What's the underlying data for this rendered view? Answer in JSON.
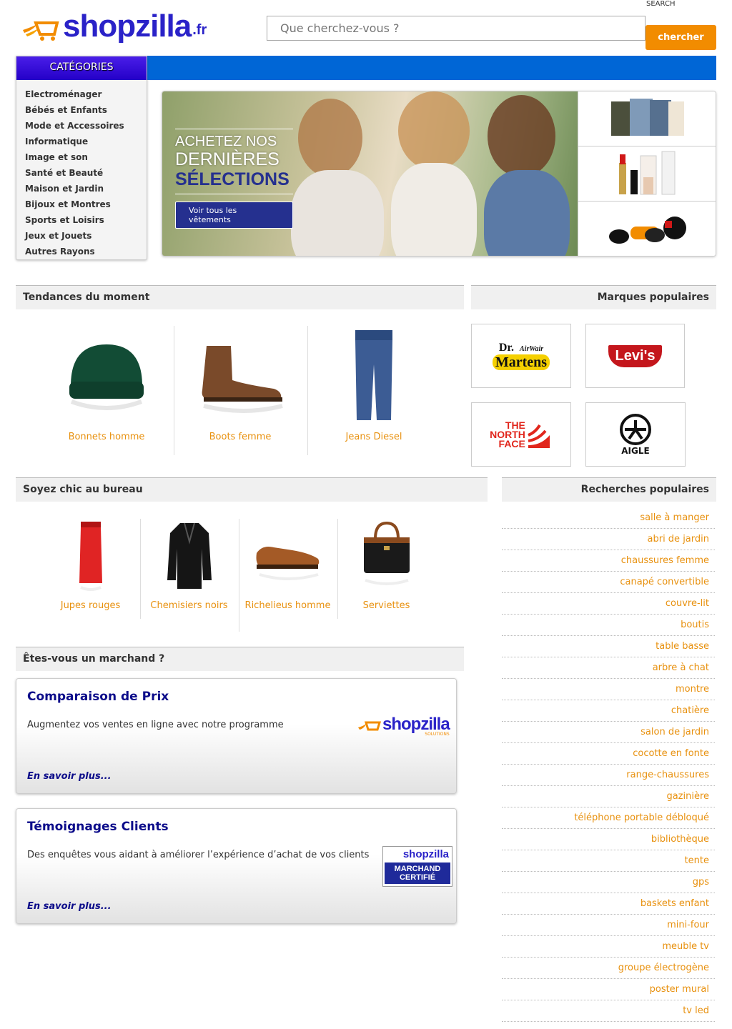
{
  "header": {
    "logo_text": "shopzilla",
    "logo_tld": ".fr",
    "search_label": "SEARCH",
    "search_placeholder": "Que cherchez-vous ?",
    "search_button": "chercher"
  },
  "categories": {
    "title": "CATÉGORIES",
    "items": [
      "Electroménager",
      "Bébés et Enfants",
      "Mode et Accessoires",
      "Informatique",
      "Image et son",
      "Santé et Beauté",
      "Maison et Jardin",
      "Bijoux et Montres",
      "Sports et Loisirs",
      "Jeux et Jouets",
      "Autres Rayons"
    ]
  },
  "banner": {
    "line1": "ACHETEZ NOS",
    "line2": "DERNIÈRES",
    "line3": "SÉLECTIONS",
    "button": "Voir tous les vêtements"
  },
  "trends": {
    "title": "Tendances du moment",
    "items": [
      {
        "label": "Bonnets homme",
        "icon": "beanie-icon"
      },
      {
        "label": "Boots femme",
        "icon": "boot-icon"
      },
      {
        "label": "Jeans Diesel",
        "icon": "jeans-icon"
      }
    ]
  },
  "brands": {
    "title": "Marques populaires",
    "items": [
      {
        "line1": "Dr.",
        "line2": "Martens",
        "sub": "AirWair"
      },
      {
        "label": "Levi's"
      },
      {
        "line1": "THE",
        "line2": "NORTH",
        "line3": "FACE"
      },
      {
        "label": "AIGLE"
      }
    ]
  },
  "office": {
    "title": "Soyez chic au bureau",
    "items": [
      {
        "label": "Jupes rouges",
        "icon": "red-skirt-icon"
      },
      {
        "label": "Chemisiers noirs",
        "icon": "black-blouse-icon"
      },
      {
        "label": "Richelieus homme",
        "icon": "derby-shoe-icon"
      },
      {
        "label": "Serviettes",
        "icon": "briefcase-icon"
      }
    ]
  },
  "popular": {
    "title": "Recherches populaires",
    "items": [
      "salle à manger",
      "abri de jardin",
      "chaussures femme",
      "canapé convertible",
      "couvre-lit",
      "boutis",
      "table basse",
      "arbre à chat",
      "montre",
      "chatière",
      "salon de jardin",
      "cocotte en fonte",
      "range-chaussures",
      "gazinière",
      "téléphone portable débloqué",
      "bibliothèque",
      "tente",
      "gps",
      "baskets enfant",
      "mini-four",
      "meuble tv",
      "groupe électrogène",
      "poster mural",
      "tv led"
    ]
  },
  "merchant": {
    "title": "Êtes-vous un marchand ?",
    "cards": [
      {
        "title": "Comparaison de Prix",
        "desc": "Augmentez vos ventes en ligne avec notre programme",
        "link": "En savoir plus...",
        "badge_text": "shopzilla",
        "badge_sub": "SOLUTIONS"
      },
      {
        "title": "Témoignages Clients",
        "desc": "Des enquêtes vous aidant à améliorer l’expérience d’achat de vos clients",
        "link": "En savoir plus...",
        "badge_text": "shopzilla",
        "badge_sub1": "MARCHAND",
        "badge_sub2": "CERTIFIÉ"
      }
    ]
  },
  "colors": {
    "accent": "#f28c00",
    "brand_blue": "#2a22c8",
    "bar_blue": "#0066d6",
    "link_orange": "#e8910f",
    "card_title": "#0c0c8a"
  }
}
